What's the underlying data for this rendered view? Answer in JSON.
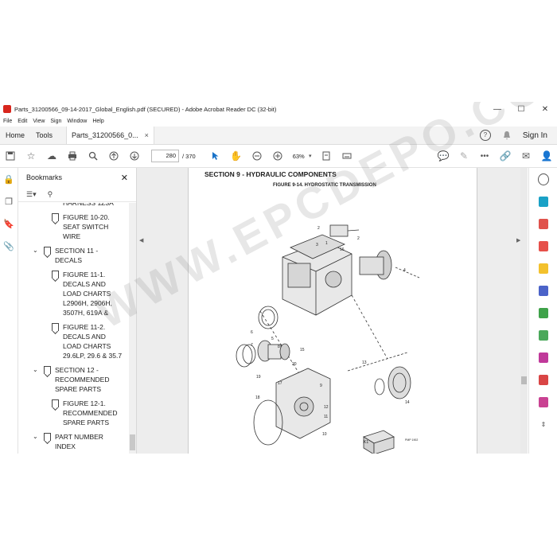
{
  "window": {
    "title": "Parts_31200566_09-14-2017_Global_English.pdf (SECURED) - Adobe Acrobat Reader DC (32-bit)",
    "controls": [
      "—",
      "☐",
      "✕"
    ]
  },
  "menu": [
    "File",
    "Edit",
    "View",
    "Sign",
    "Window",
    "Help"
  ],
  "tabs": {
    "home": "Home",
    "tools": "Tools",
    "document": "Parts_31200566_0...",
    "close": "×",
    "signin": "Sign In"
  },
  "toolbar": {
    "page_current": "280",
    "page_total": "/ 370",
    "zoom": "63%"
  },
  "bookmarks": {
    "title": "Bookmarks",
    "items": [
      {
        "text": "HARNESS 1Z3A",
        "level": 2
      },
      {
        "text": "FIGURE 10-20. SEAT SWITCH WIRE",
        "level": 2
      },
      {
        "text": "SECTION 11 - DECALS",
        "level": 1
      },
      {
        "text": "FIGURE 11-1. DECALS AND LOAD CHARTS L2906H, 2906H, 3507H, 619A &",
        "level": 2
      },
      {
        "text": "FIGURE 11-2. DECALS AND LOAD CHARTS 29.6LP, 29.6 & 35.7",
        "level": 2
      },
      {
        "text": "SECTION 12 - RECOMMENDED SPARE PARTS",
        "level": 1
      },
      {
        "text": "FIGURE 12-1. RECOMMENDED SPARE PARTS",
        "level": 2
      },
      {
        "text": "PART NUMBER INDEX",
        "level": 1
      }
    ]
  },
  "page": {
    "section": "SECTION 9 - HYDRAULIC COMPONENTS",
    "figure": "FIGURE 9-14. HYDROSTATIC TRANSMISSION",
    "callouts": [
      "1",
      "2",
      "3",
      "4",
      "5",
      "6",
      "7",
      "8",
      "9",
      "10",
      "11",
      "12",
      "13",
      "14",
      "15",
      "16",
      "17",
      "18",
      "19",
      "20",
      "K1"
    ],
    "drawing_id": "PMP 1902"
  },
  "watermark": "WWW.EPCDEPO.COM"
}
